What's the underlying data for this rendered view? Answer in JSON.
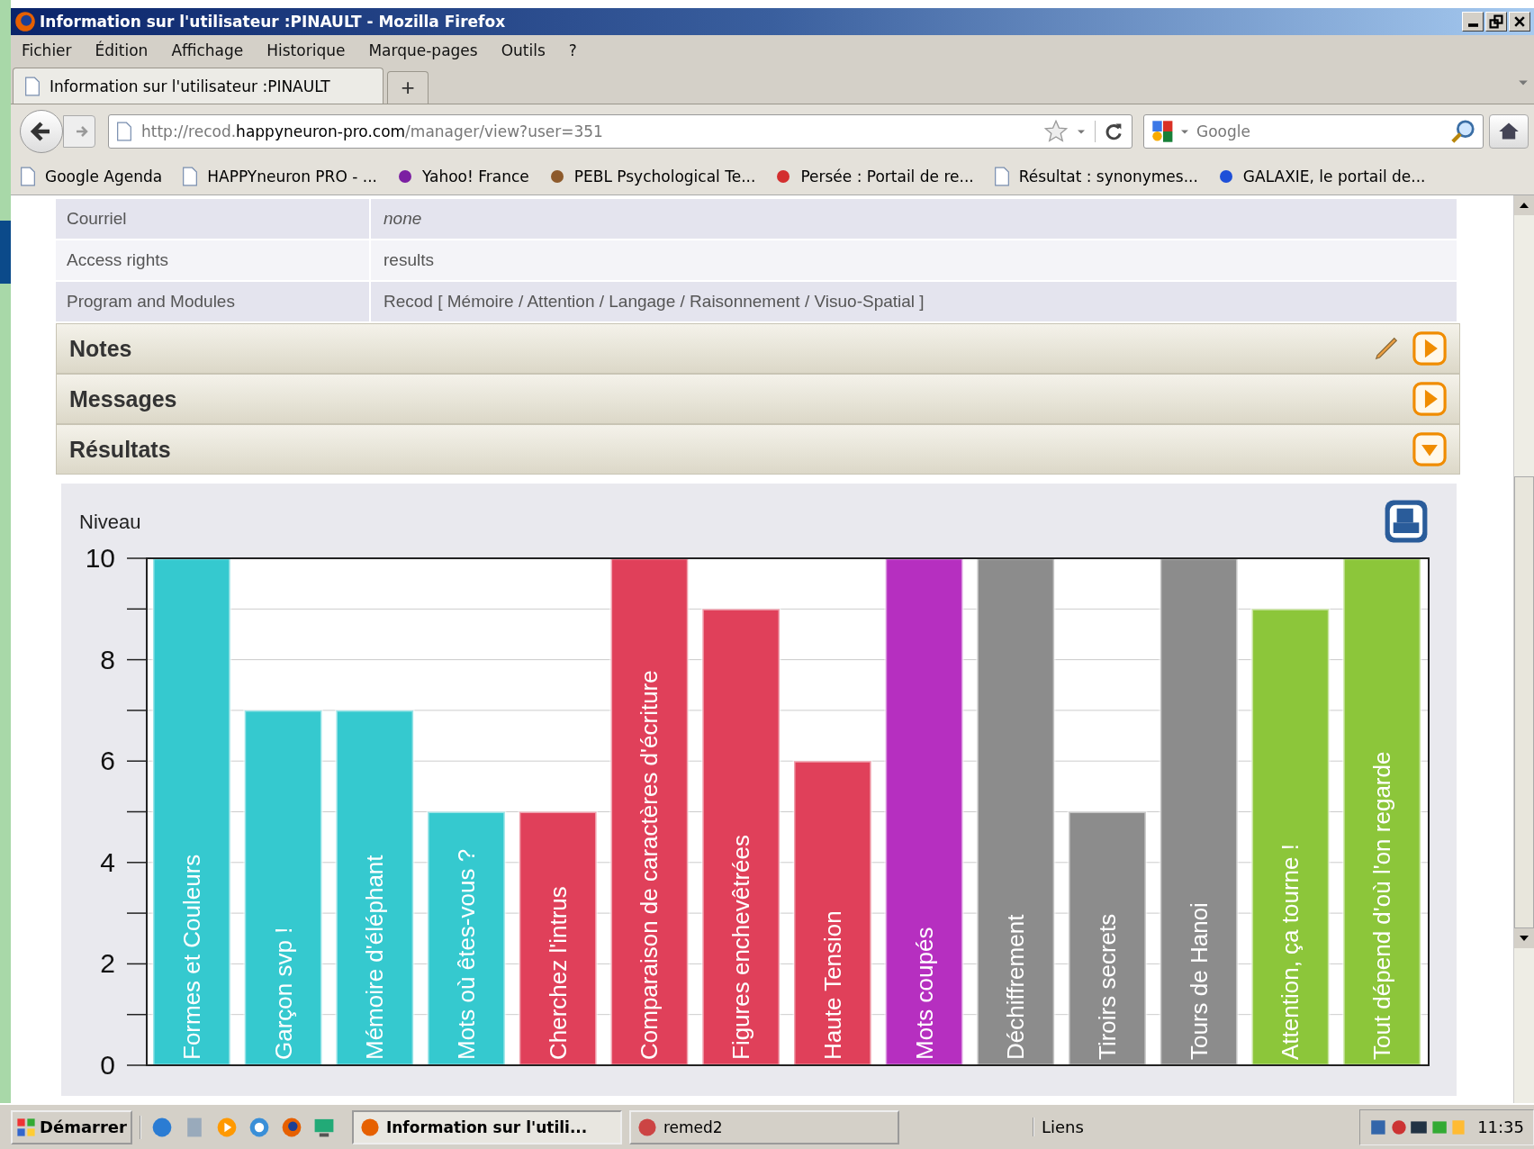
{
  "window": {
    "title": "Information sur l'utilisateur :PINAULT - Mozilla Firefox"
  },
  "menu": [
    "Fichier",
    "Édition",
    "Affichage",
    "Historique",
    "Marque-pages",
    "Outils",
    "?"
  ],
  "tabs": [
    {
      "label": "Information sur l'utilisateur :PINAULT",
      "selected": true
    }
  ],
  "new_tab": "+",
  "address": {
    "prefix": "http://recod.",
    "host": "happyneuron-pro.com",
    "path": "/manager/view?user=351"
  },
  "search": {
    "placeholder": "Google"
  },
  "bookmarks": [
    {
      "label": "Google Agenda",
      "kind": "page"
    },
    {
      "label": "HAPPYneuron PRO - ...",
      "kind": "page"
    },
    {
      "label": "Yahoo! France",
      "kind": "purple"
    },
    {
      "label": "PEBL Psychological Te...",
      "kind": "brown"
    },
    {
      "label": "Persée : Portail de re...",
      "kind": "red"
    },
    {
      "label": "Résultat : synonymes...",
      "kind": "page"
    },
    {
      "label": "GALAXIE, le portail de...",
      "kind": "blue"
    }
  ],
  "user_info": [
    {
      "label": "Courriel",
      "value": "none",
      "empty": true
    },
    {
      "label": "Access rights",
      "value": "results",
      "empty": false
    },
    {
      "label": "Program and Modules",
      "value": "Recod [ Mémoire / Attention / Langage / Raisonnement / Visuo-Spatial ]",
      "empty": false
    }
  ],
  "sections": [
    {
      "title": "Notes",
      "expanded": false,
      "editable": true
    },
    {
      "title": "Messages",
      "expanded": false,
      "editable": false
    },
    {
      "title": "Résultats",
      "expanded": true,
      "editable": false
    }
  ],
  "chart_data": {
    "type": "bar",
    "grid": true,
    "ylabel": "Niveau",
    "ylim": [
      0,
      10
    ],
    "yticks": [
      0,
      2,
      4,
      6,
      8,
      10
    ],
    "categories": [
      "Formes et Couleurs",
      "Garçon svp !",
      "Mémoire d'éléphant",
      "Mots où êtes-vous ?",
      "Cherchez l'intrus",
      "Comparaison de caractères d'écriture",
      "Figures enchevêtrées",
      "Haute Tension",
      "Mots coupés",
      "Déchiffrement",
      "Tiroirs secrets",
      "Tours de Hanoi",
      "Attention, ça tourne !",
      "Tout dépend d'où l'on regarde"
    ],
    "values": [
      10,
      7,
      7,
      5,
      5,
      10,
      9,
      6,
      10,
      10,
      5,
      10,
      9,
      10
    ],
    "colors": [
      "#35c9cf",
      "#35c9cf",
      "#35c9cf",
      "#35c9cf",
      "#e0405a",
      "#e0405a",
      "#e0405a",
      "#e0405a",
      "#b62fc0",
      "#8c8c8c",
      "#8c8c8c",
      "#8c8c8c",
      "#8cc63a",
      "#8cc63a"
    ]
  },
  "taskbar": {
    "start": "Démarrer",
    "tasks": [
      {
        "label": "Information sur l'utili...",
        "selected": true
      },
      {
        "label": "remed2",
        "selected": false
      }
    ],
    "links": "Liens",
    "clock": "11:35"
  }
}
